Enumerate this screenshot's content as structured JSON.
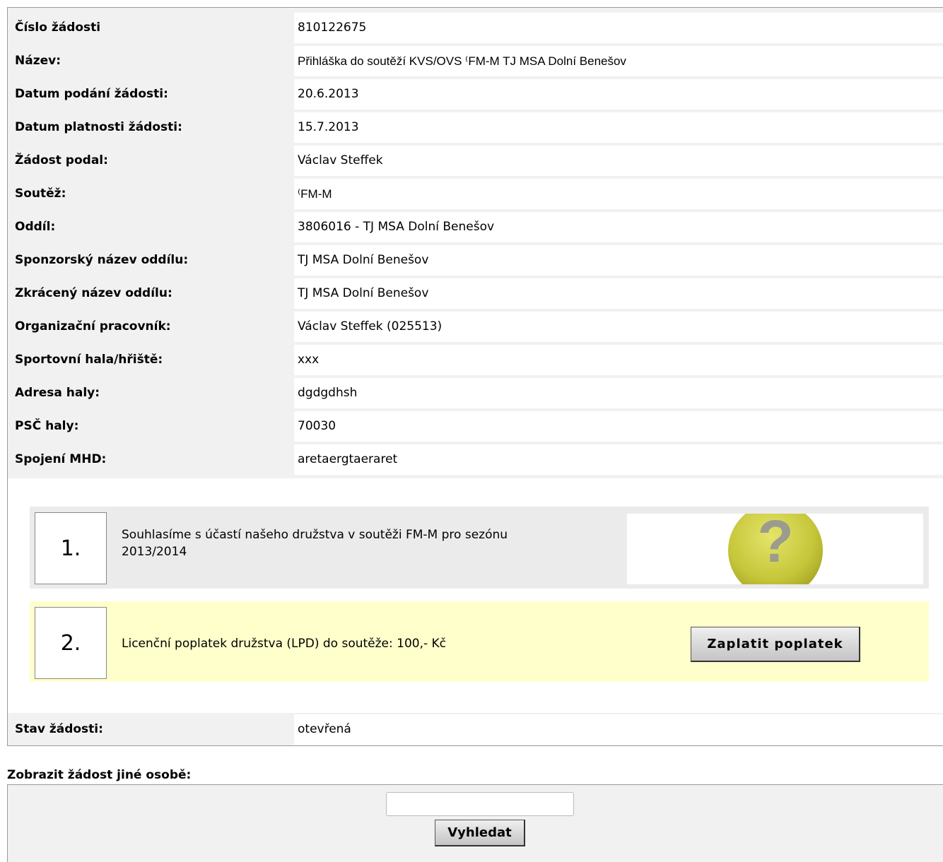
{
  "detail_rows": [
    {
      "label": "Číslo žádosti",
      "value": "810122675"
    },
    {
      "label": "Název:",
      "value": "Přihláška do soutěží KVS/OVS ⁽FM-M  TJ MSA Dolní Benešov"
    },
    {
      "label": "Datum podání žádosti:",
      "value": "20.6.2013"
    },
    {
      "label": "Datum platnosti žádosti:",
      "value": "15.7.2013"
    },
    {
      "label": "Žádost podal:",
      "value": "Václav Steffek"
    },
    {
      "label": "Soutěž:",
      "value": "⁽FM-M"
    },
    {
      "label": "Oddíl:",
      "value": "3806016 - TJ MSA Dolní Benešov"
    },
    {
      "label": "Sponzorský název oddílu:",
      "value": "TJ MSA Dolní Benešov"
    },
    {
      "label": "Zkrácený název oddílu:",
      "value": "TJ MSA Dolní Benešov"
    },
    {
      "label": "Organizační pracovník:",
      "value": "Václav Steffek (025513)"
    },
    {
      "label": "Sportovní hala/hřiště:",
      "value": "xxx"
    },
    {
      "label": "Adresa haly:",
      "value": "dgdgdhsh"
    },
    {
      "label": "PSČ haly:",
      "value": "70030"
    },
    {
      "label": "Spojení MHD:",
      "value": "aretaergtaeraret"
    }
  ],
  "steps": {
    "step1": {
      "number": "1.",
      "text": "Souhlasíme s účastí našeho družstva v soutěži  FM-M pro sezónu 2013/2014",
      "status_icon": "question-mark-icon",
      "status_icon_color": "#c9c93a"
    },
    "step2": {
      "number": "2.",
      "text": "Licenční poplatek družstva (LPD) do soutěže: 100,- Kč",
      "button_label": "Zaplatit poplatek",
      "background": "#ffffcc"
    }
  },
  "status": {
    "label": "Stav žádosti:",
    "value": "otevřená"
  },
  "other_person": {
    "title": "Zobrazit žádost jiné osobě:",
    "input_value": "",
    "button_label": "Vyhledat"
  }
}
